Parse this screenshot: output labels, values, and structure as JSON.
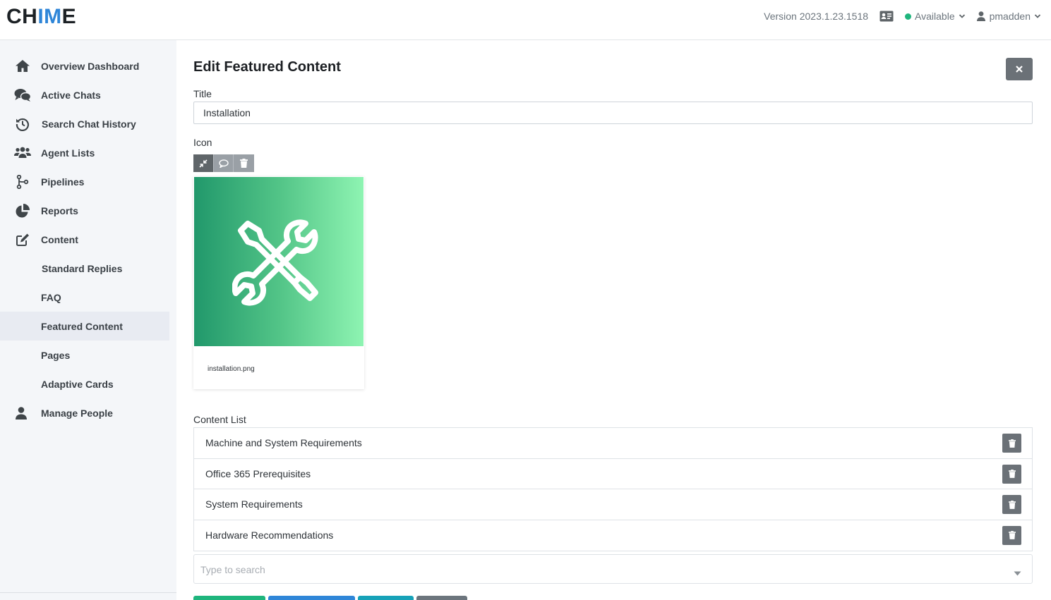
{
  "header": {
    "logo_part1": "CH",
    "logo_part2": "IM",
    "logo_part3": "E",
    "version": "Version 2023.1.23.1518",
    "status": "Available",
    "username": "pmadden",
    "status_color": "#1fb57d"
  },
  "sidebar": {
    "items": [
      {
        "label": "Overview Dashboard",
        "icon": "home-icon"
      },
      {
        "label": "Active Chats",
        "icon": "chat-icon"
      },
      {
        "label": "Search Chat History",
        "icon": "history-icon"
      },
      {
        "label": "Agent Lists",
        "icon": "users-icon"
      },
      {
        "label": "Pipelines",
        "icon": "pipeline-icon"
      },
      {
        "label": "Reports",
        "icon": "pie-chart-icon"
      },
      {
        "label": "Content",
        "icon": "edit-icon"
      },
      {
        "label": "Standard Replies"
      },
      {
        "label": "FAQ"
      },
      {
        "label": "Featured Content",
        "active": true
      },
      {
        "label": "Pages"
      },
      {
        "label": "Adaptive Cards"
      },
      {
        "label": "Manage People",
        "icon": "person-icon"
      }
    ]
  },
  "main": {
    "title": "Edit Featured Content",
    "title_label": "Title",
    "title_value": "Installation",
    "icon_label": "Icon",
    "icon_filename": "installation.png",
    "content_list_label": "Content List",
    "content_list": [
      "Machine and System Requirements",
      "Office 365 Prerequisites",
      "System Requirements",
      "Hardware Recommendations"
    ],
    "search_placeholder": "Type to search"
  },
  "colors": {
    "accent_blue": "#2f86d8",
    "button_gray": "#6b7177",
    "sidebar_bg": "#f4f6f9",
    "bottom_buttons": [
      "#1fb57d",
      "#2f86d8",
      "#17a2b8",
      "#6c757d"
    ]
  }
}
